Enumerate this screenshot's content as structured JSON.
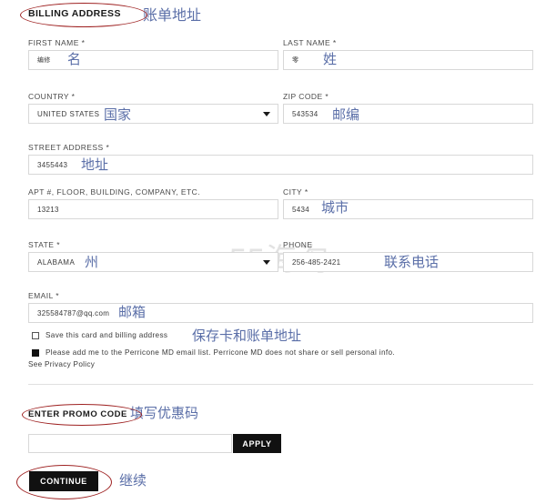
{
  "section": {
    "billing_title": "BILLING ADDRESS",
    "billing_title_cn": "账单地址"
  },
  "fields": {
    "first_name": {
      "label": "FIRST NAME *",
      "value": "编修",
      "annotation": "名"
    },
    "last_name": {
      "label": "LAST NAME *",
      "value": "零",
      "annotation": "姓"
    },
    "country": {
      "label": "COUNTRY *",
      "value": "UNITED STATES",
      "annotation": "国家",
      "caret": "chevron-down-icon"
    },
    "zip_code": {
      "label": "ZIP CODE *",
      "value": "543534",
      "annotation": "邮编"
    },
    "street_address": {
      "label": "STREET ADDRESS *",
      "value": "3455443",
      "annotation": "地址"
    },
    "apt": {
      "label": "APT #, FLOOR, BUILDING, COMPANY, ETC.",
      "value": "13213",
      "annotation": ""
    },
    "city": {
      "label": "CITY *",
      "value": "5434",
      "annotation": "城市"
    },
    "state": {
      "label": "STATE *",
      "value": "ALABAMA",
      "annotation": "州",
      "caret": "chevron-down-icon"
    },
    "phone": {
      "label": "PHONE",
      "value": "256-485-2421",
      "annotation": "联系电话"
    },
    "email": {
      "label": "EMAIL *",
      "value": "325584787@qq.com",
      "annotation": "邮箱"
    }
  },
  "checkboxes": {
    "save_card": {
      "label": "Save this card and billing address",
      "checked": false,
      "annotation": "保存卡和账单地址"
    },
    "email_list": {
      "label": "Please add me to the Perricone MD email list. Perricone MD does not share or sell personal info.",
      "checked": true
    },
    "privacy_link": "See Privacy Policy"
  },
  "promo": {
    "title": "ENTER PROMO CODE",
    "title_cn": "填写优惠码",
    "input_value": "",
    "placeholder": "",
    "apply_label": "APPLY"
  },
  "continue": {
    "label": "CONTINUE",
    "annotation": "继续"
  },
  "watermark": "55海淘",
  "colors": {
    "annotation": "#5b6fa8",
    "ellipse": "#9e2121",
    "button": "#111111",
    "border": "#d8d8d8",
    "watermark": "#e2e2e2"
  }
}
